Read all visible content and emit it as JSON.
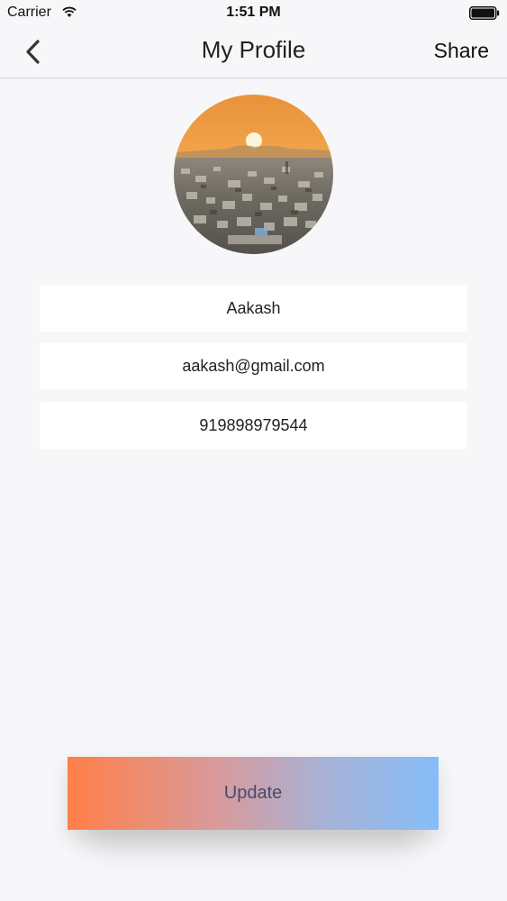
{
  "status_bar": {
    "carrier": "Carrier",
    "time": "1:51 PM",
    "wifi_icon": "wifi-icon",
    "battery_icon": "battery-full-icon"
  },
  "nav": {
    "back_icon": "chevron-left-icon",
    "title": "My Profile",
    "share_label": "Share"
  },
  "profile": {
    "avatar": "city-sunset-photo",
    "name": "Aakash",
    "email": "aakash@gmail.com",
    "phone": "919898979544"
  },
  "actions": {
    "update_label": "Update"
  },
  "colors": {
    "background": "#f7f7f9",
    "field_background": "#ffffff",
    "update_gradient_start": "#ff7f48",
    "update_gradient_end": "#86bdf7",
    "update_text": "#4a4a6e"
  }
}
